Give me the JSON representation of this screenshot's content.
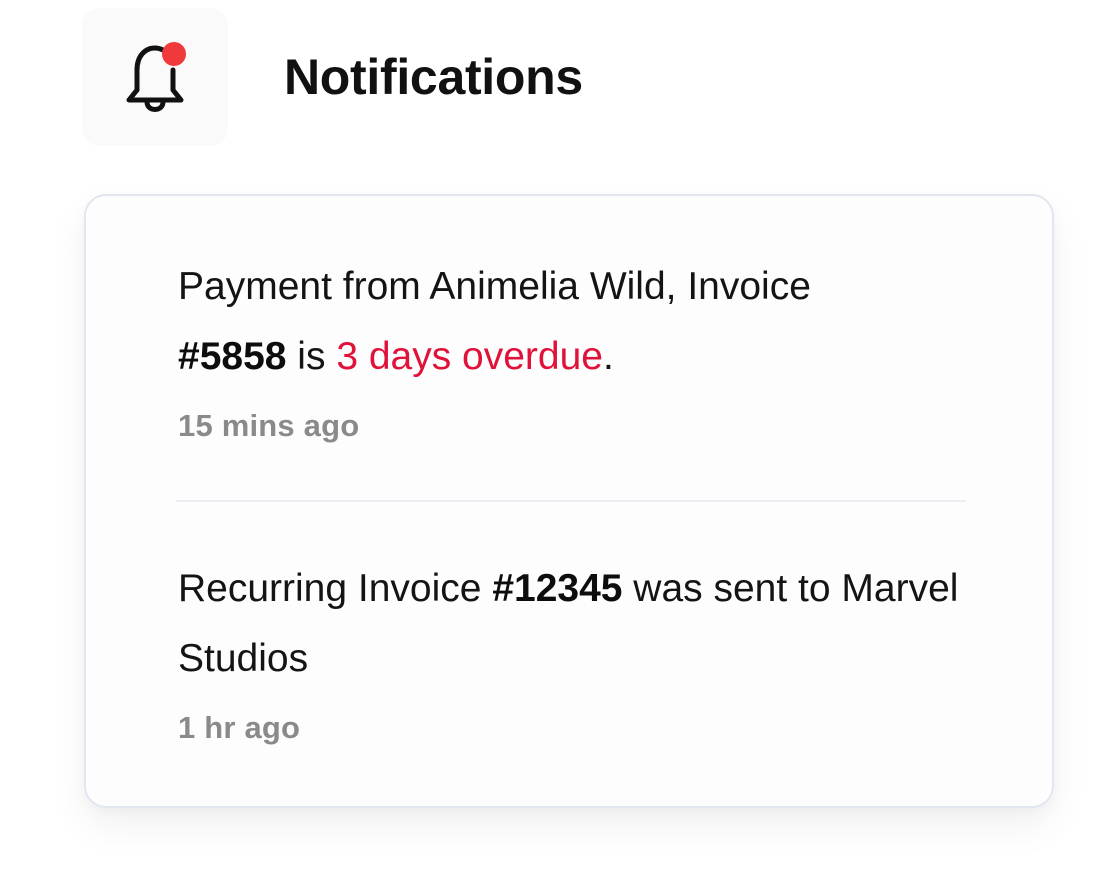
{
  "header": {
    "title": "Notifications",
    "bell_icon": "bell-icon",
    "unread_dot_color": "#f0393b"
  },
  "notifications": [
    {
      "text_before": "Payment from Animelia Wild, Invoice",
      "invoice_number": "#5858",
      "text_middle": "is",
      "overdue_text": "3 days overdue",
      "text_after": ".",
      "time": "15 mins ago"
    },
    {
      "text_before": "Recurring Invoice",
      "invoice_number": "#12345",
      "text_after": "was sent to Marvel Studios",
      "time": "1 hr ago"
    }
  ],
  "colors": {
    "overdue": "#e0123a",
    "timestamp": "#8a8a8a",
    "card_border": "#e2e6f0"
  }
}
